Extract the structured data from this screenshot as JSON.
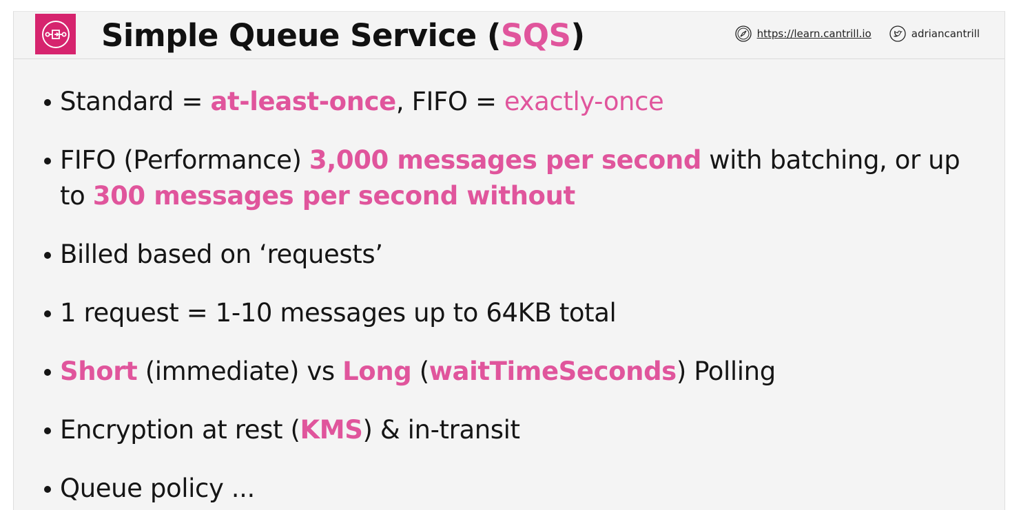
{
  "header": {
    "title_prefix": "Simple Queue Service (",
    "title_accent": "SQS",
    "title_suffix": ")",
    "site_link": "https://learn.cantrill.io",
    "twitter_handle": "adriancantrill",
    "logo_icon": "sqs-queue-icon",
    "site_icon": "compass-icon",
    "twitter_icon": "twitter-bird-icon"
  },
  "colors": {
    "accent": "#e0559c",
    "logo_bg": "#d6246e",
    "text": "#151515",
    "background": "#f4f4f4"
  },
  "bullets": [
    {
      "segments": [
        {
          "text": "Standard = ",
          "style": "n"
        },
        {
          "text": "at-least-once",
          "style": "pb"
        },
        {
          "text": ", FIFO = ",
          "style": "n"
        },
        {
          "text": "exactly-once",
          "style": "pn"
        }
      ]
    },
    {
      "segments": [
        {
          "text": "FIFO (Performance) ",
          "style": "n"
        },
        {
          "text": "3,000 messages per second",
          "style": "pb"
        },
        {
          "text": " with batching, or up to ",
          "style": "n"
        },
        {
          "text": "300 messages per second without",
          "style": "pb"
        }
      ]
    },
    {
      "segments": [
        {
          "text": "Billed based on ‘requests’",
          "style": "n"
        }
      ]
    },
    {
      "segments": [
        {
          "text": "1 request = 1-10 messages up to 64KB total",
          "style": "n"
        }
      ]
    },
    {
      "segments": [
        {
          "text": "Short",
          "style": "pb"
        },
        {
          "text": " (immediate) vs ",
          "style": "n"
        },
        {
          "text": "Long",
          "style": "pb"
        },
        {
          "text": " (",
          "style": "n"
        },
        {
          "text": "waitTimeSeconds",
          "style": "pb"
        },
        {
          "text": ") Polling",
          "style": "n"
        }
      ]
    },
    {
      "segments": [
        {
          "text": "Encryption at rest (",
          "style": "n"
        },
        {
          "text": "KMS",
          "style": "pb"
        },
        {
          "text": ") & in-transit",
          "style": "n"
        }
      ]
    },
    {
      "segments": [
        {
          "text": "Queue policy ...",
          "style": "n"
        }
      ]
    }
  ]
}
